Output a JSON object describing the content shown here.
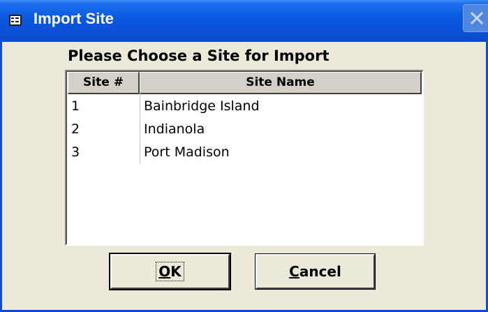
{
  "window": {
    "title": "Import Site",
    "icon": "form-icon",
    "close_icon": "close-icon"
  },
  "prompt": "Please Choose a Site for Import",
  "list": {
    "columns": [
      "Site #",
      "Site Name"
    ],
    "rows": [
      {
        "num": "1",
        "name": "Bainbridge Island"
      },
      {
        "num": "2",
        "name": "Indianola"
      },
      {
        "num": "3",
        "name": "Port Madison"
      }
    ]
  },
  "buttons": {
    "ok_mnemonic": "O",
    "ok_rest": "K",
    "cancel_mnemonic": "C",
    "cancel_rest": "ancel"
  },
  "colors": {
    "titlebar": "#0a52d8",
    "dialog_bg": "#ece9d8",
    "header_bg": "#d4d0c8"
  }
}
